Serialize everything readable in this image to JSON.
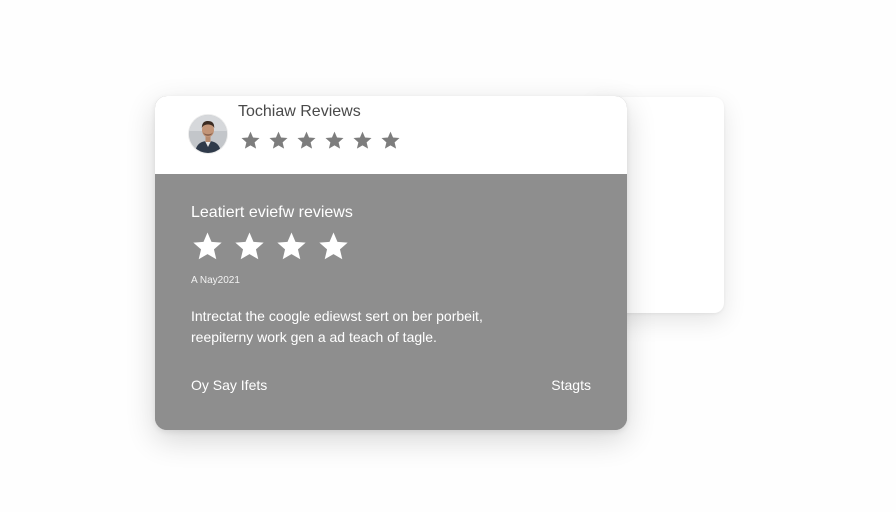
{
  "header": {
    "title": "Tochiaw Reviews",
    "rating": 6,
    "star_color": "#7d7d7d"
  },
  "review": {
    "title": "Leatiert eviefw reviews",
    "rating": 4,
    "star_color": "#ffffff",
    "date": "A Nay2021",
    "text_lines": [
      "Intrectat the coogle  ediewst sert on ber porbeit,",
      "reepiterny work gen a ad teach of tagle."
    ],
    "footer_left": "Oy Say Ifets",
    "footer_right": "Stagts"
  },
  "colors": {
    "card_body": "#8e8e8e",
    "card_header": "#ffffff"
  }
}
